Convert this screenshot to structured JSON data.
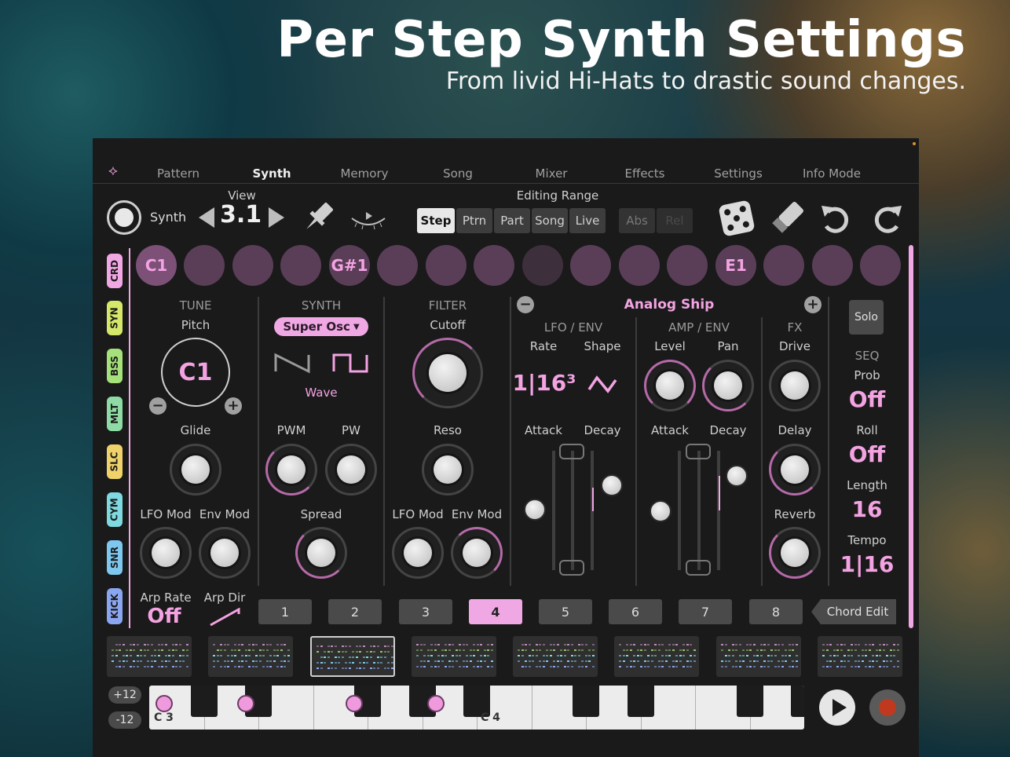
{
  "hero": {
    "title": "Per Step Synth Settings",
    "subtitle": "From livid Hi-Hats to drastic sound changes."
  },
  "nav": {
    "tabs": [
      "Pattern",
      "Synth",
      "Memory",
      "Song",
      "Mixer",
      "Effects",
      "Settings",
      "Info Mode"
    ],
    "active": "Synth"
  },
  "toolbar": {
    "synth_label": "Synth",
    "view_label": "View",
    "view_value": "3.1",
    "editing_range_label": "Editing Range",
    "ranges": [
      "Step",
      "Ptrn",
      "Part",
      "Song",
      "Live"
    ],
    "active_range": "Step",
    "abs_label": "Abs",
    "rel_label": "Rel",
    "icons": [
      "pin-icon",
      "eye-icon",
      "dice-icon",
      "eraser-icon",
      "undo-icon",
      "redo-icon"
    ]
  },
  "tracks": [
    "CRD",
    "SYN",
    "BSS",
    "MLT",
    "SLC",
    "CYM",
    "SNR",
    "KICK"
  ],
  "track_colors": [
    "#f0a8e4",
    "#d6e86a",
    "#a6e07a",
    "#8fdba6",
    "#f0d26a",
    "#7fd9e0",
    "#7ec8f0",
    "#8aa6f0"
  ],
  "steps": [
    "C1",
    "",
    "",
    "",
    "G#1",
    "",
    "",
    "",
    "",
    "",
    "",
    "",
    "E1",
    "",
    "",
    ""
  ],
  "tune": {
    "header": "TUNE",
    "pitch_label": "Pitch",
    "pitch_value": "C1",
    "glide_label": "Glide",
    "lfo_mod_label": "LFO Mod",
    "env_mod_label": "Env Mod",
    "arp_rate_label": "Arp Rate",
    "arp_rate_value": "Off",
    "arp_dir_label": "Arp Dir"
  },
  "synth": {
    "header": "SYNTH",
    "osc_value": "Super Osc",
    "wave_label": "Wave",
    "pwm_label": "PWM",
    "pw_label": "PW",
    "spread_label": "Spread"
  },
  "filter": {
    "header": "FILTER",
    "cutoff_label": "Cutoff",
    "reso_label": "Reso",
    "lfo_mod_label": "LFO Mod",
    "env_mod_label": "Env Mod"
  },
  "preset": {
    "name": "Analog Ship"
  },
  "lfo_env": {
    "header": "LFO / ENV",
    "rate_label": "Rate",
    "shape_label": "Shape",
    "rate_value": "1|16³",
    "attack_label": "Attack",
    "decay_label": "Decay"
  },
  "amp_env": {
    "header": "AMP / ENV",
    "level_label": "Level",
    "pan_label": "Pan",
    "attack_label": "Attack",
    "decay_label": "Decay"
  },
  "fx": {
    "header": "FX",
    "drive_label": "Drive",
    "delay_label": "Delay",
    "reverb_label": "Reverb"
  },
  "seq": {
    "solo_label": "Solo",
    "header": "SEQ",
    "prob_label": "Prob",
    "prob_value": "Off",
    "roll_label": "Roll",
    "roll_value": "Off",
    "length_label": "Length",
    "length_value": "16",
    "tempo_label": "Tempo",
    "tempo_value": "1|16"
  },
  "patterns": {
    "numbers": [
      "1",
      "2",
      "3",
      "4",
      "5",
      "6",
      "7",
      "8"
    ],
    "active": 4,
    "chord_edit_label": "Chord Edit"
  },
  "keyboard": {
    "octave_up": "+12",
    "octave_down": "-12",
    "label_c3": "C 3",
    "label_c4": "C 4"
  },
  "colors": {
    "accent": "#f0a8e4",
    "panel": "#1a1a1a"
  }
}
